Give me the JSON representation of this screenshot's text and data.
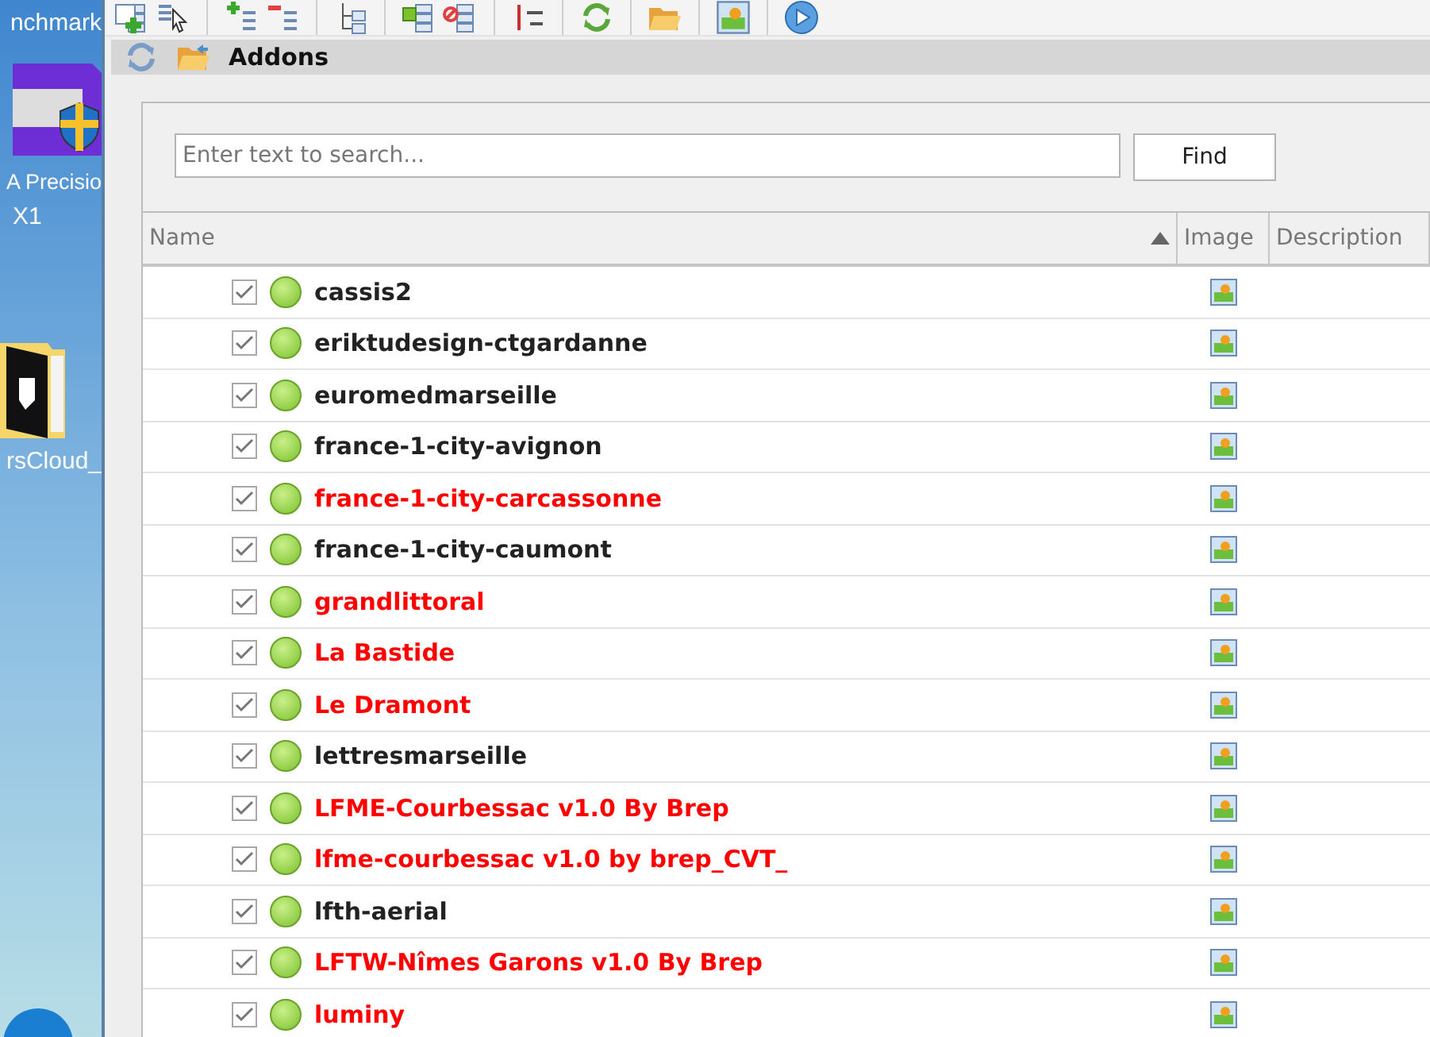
{
  "desktop": {
    "icons": [
      {
        "label": "nchmark"
      },
      {
        "label": "A Precisio"
      },
      {
        "label": "X1"
      },
      {
        "label": "rsCloud_"
      }
    ]
  },
  "panel": {
    "title": "Addons"
  },
  "search": {
    "placeholder": "Enter text to search...",
    "button": "Find"
  },
  "table": {
    "columns": [
      {
        "label": "Name",
        "sorted": true
      },
      {
        "label": "Image",
        "sorted": false
      },
      {
        "label": "Description",
        "sorted": false
      }
    ],
    "rows": [
      {
        "name": "cassis2",
        "checked": true,
        "color": "#222222"
      },
      {
        "name": "eriktudesign-ctgardanne",
        "checked": true,
        "color": "#222222"
      },
      {
        "name": "euromedmarseille",
        "checked": true,
        "color": "#222222"
      },
      {
        "name": "france-1-city-avignon",
        "checked": true,
        "color": "#222222"
      },
      {
        "name": "france-1-city-carcassonne",
        "checked": true,
        "color": "#ff0000"
      },
      {
        "name": "france-1-city-caumont",
        "checked": true,
        "color": "#222222"
      },
      {
        "name": "grandlittoral",
        "checked": true,
        "color": "#ff0000"
      },
      {
        "name": "La Bastide",
        "checked": true,
        "color": "#ff0000"
      },
      {
        "name": "Le Dramont",
        "checked": true,
        "color": "#ff0000"
      },
      {
        "name": "lettresmarseille",
        "checked": true,
        "color": "#222222"
      },
      {
        "name": "LFME-Courbessac v1.0 By Brep",
        "checked": true,
        "color": "#ff0000"
      },
      {
        "name": "lfme-courbessac v1.0 by brep_CVT_",
        "checked": true,
        "color": "#ff0000"
      },
      {
        "name": "lfth-aerial",
        "checked": true,
        "color": "#222222"
      },
      {
        "name": "LFTW-Nîmes Garons v1.0 By Brep",
        "checked": true,
        "color": "#ff0000"
      },
      {
        "name": "luminy",
        "checked": true,
        "color": "#ff0000"
      }
    ]
  }
}
